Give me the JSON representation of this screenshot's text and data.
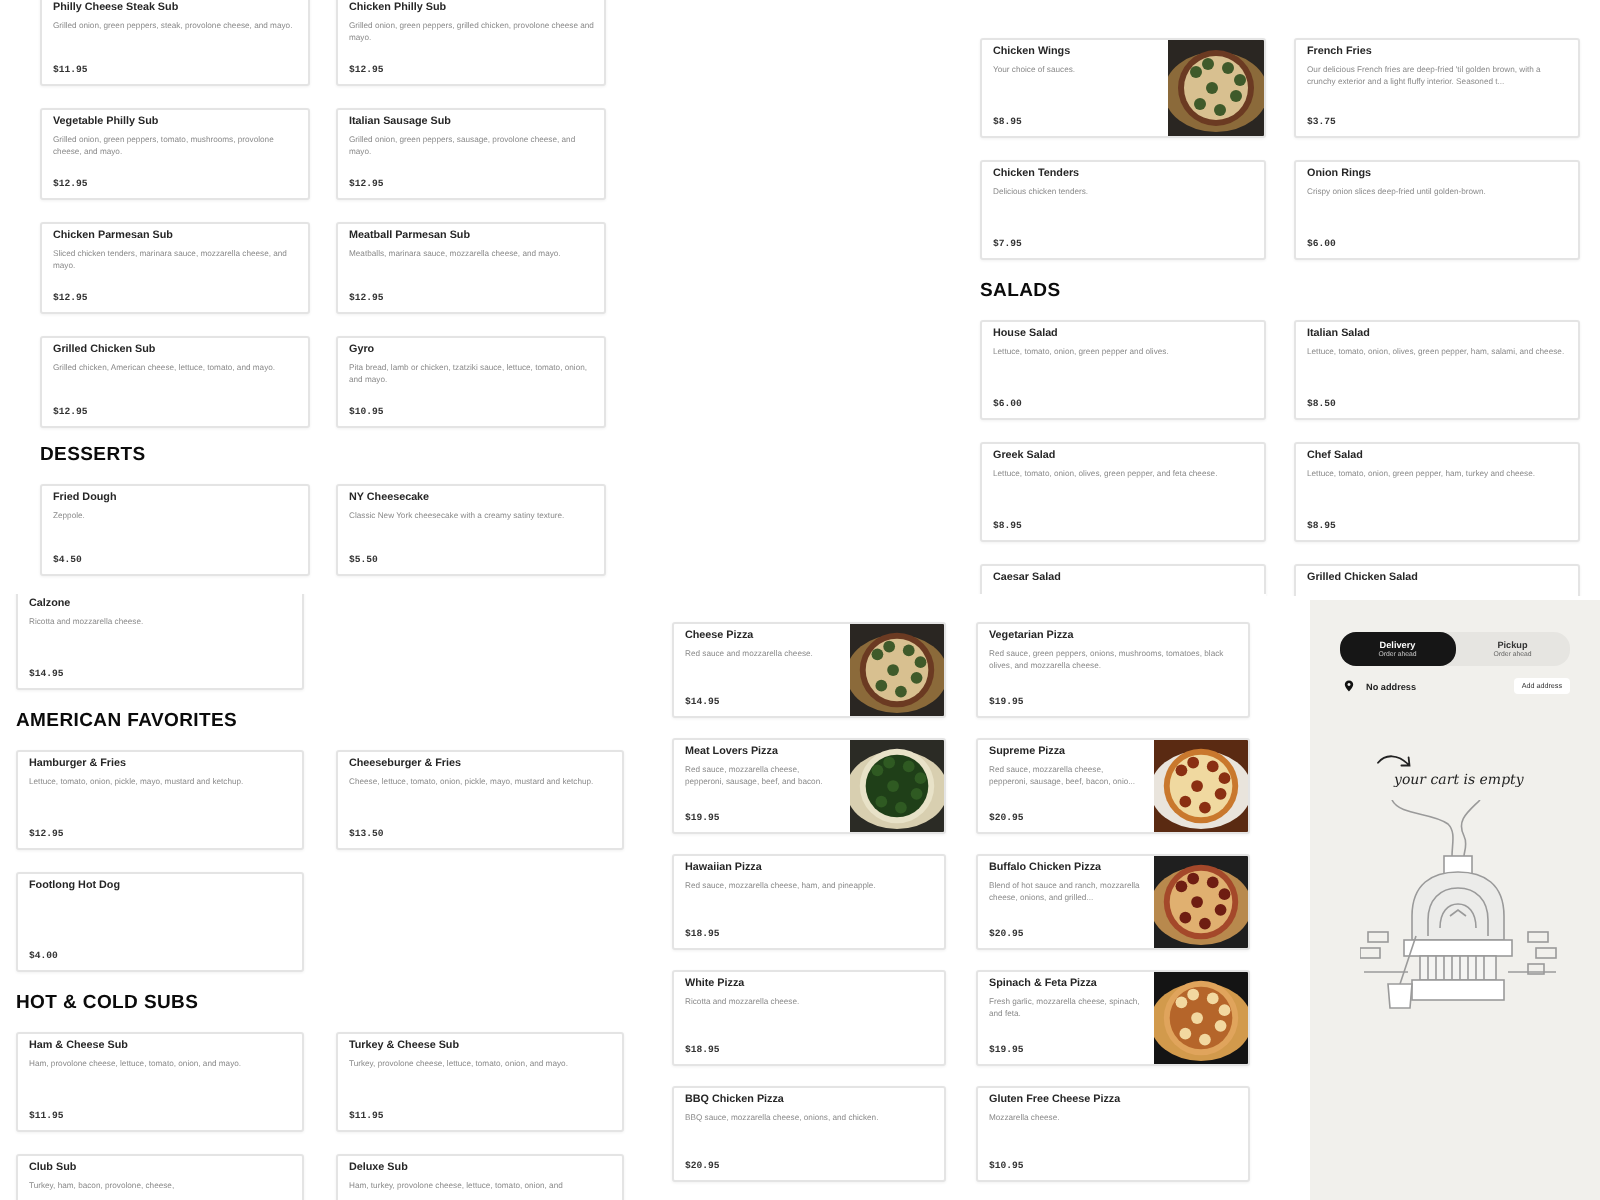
{
  "panels": [
    {
      "kind": "menu",
      "sections": [
        {
          "items": [
            {
              "name": "Philly Cheese Steak Sub",
              "description": "Grilled onion, green peppers, steak, provolone cheese, and mayo.",
              "price": "$11.95"
            },
            {
              "name": "Chicken Philly Sub",
              "description": "Grilled onion, green peppers, grilled chicken, provolone cheese and mayo.",
              "price": "$12.95"
            },
            {
              "name": "Vegetable Philly Sub",
              "description": "Grilled onion, green peppers, tomato, mushrooms, provolone cheese, and mayo.",
              "price": "$12.95"
            },
            {
              "name": "Italian Sausage Sub",
              "description": "Grilled onion, green peppers, sausage, provolone cheese, and mayo.",
              "price": "$12.95"
            },
            {
              "name": "Chicken Parmesan Sub",
              "description": "Sliced chicken tenders, marinara sauce, mozzarella cheese, and mayo.",
              "price": "$12.95"
            },
            {
              "name": "Meatball Parmesan Sub",
              "description": "Meatballs, marinara sauce, mozzarella cheese, and mayo.",
              "price": "$12.95"
            },
            {
              "name": "Grilled Chicken Sub",
              "description": "Grilled chicken, American cheese, lettuce, tomato, and mayo.",
              "price": "$12.95"
            },
            {
              "name": "Gyro",
              "description": "Pita bread, lamb or chicken, tzatziki sauce, lettuce, tomato, onion, and mayo.",
              "price": "$10.95"
            }
          ]
        },
        {
          "heading": "DESSERTS",
          "items": [
            {
              "name": "Fried Dough",
              "description": "Zeppole.",
              "price": "$4.50"
            },
            {
              "name": "NY Cheesecake",
              "description": "Classic New York cheesecake with a creamy satiny texture.",
              "price": "$5.50"
            }
          ]
        }
      ]
    },
    {
      "kind": "menu",
      "sections": [
        {
          "items": [
            {
              "name": "Chicken Wings",
              "description": "Your choice of sauces.",
              "price": "$8.95",
              "photo": true
            },
            {
              "name": "French Fries",
              "description": "Our delicious French fries are deep-fried 'til golden brown, with a crunchy exterior and a light fluffy interior. Seasoned t...",
              "price": "$3.75"
            },
            {
              "name": "Chicken Tenders",
              "description": "Delicious chicken tenders.",
              "price": "$7.95"
            },
            {
              "name": "Onion Rings",
              "description": "Crispy onion slices deep-fried until golden-brown.",
              "price": "$6.00"
            }
          ]
        },
        {
          "heading": "SALADS",
          "items": [
            {
              "name": "House Salad",
              "description": "Lettuce, tomato, onion, green pepper and olives.",
              "price": "$6.00"
            },
            {
              "name": "Italian Salad",
              "description": "Lettuce, tomato, onion, olives, green pepper, ham, salami, and cheese.",
              "price": "$8.50"
            },
            {
              "name": "Greek Salad",
              "description": "Lettuce, tomato, onion, olives, green pepper, and feta cheese.",
              "price": "$8.95"
            },
            {
              "name": "Chef Salad",
              "description": "Lettuce, tomato, onion, green pepper, ham, turkey and cheese.",
              "price": "$8.95"
            },
            {
              "name": "Caesar Salad"
            },
            {
              "name": "Grilled Chicken Salad"
            }
          ]
        }
      ]
    },
    {
      "kind": "menu",
      "sections": [
        {
          "items": [
            {
              "name": "Calzone",
              "description": "Ricotta and mozzarella cheese.",
              "price": "$14.95"
            }
          ]
        },
        {
          "heading": "AMERICAN FAVORITES",
          "items": [
            {
              "name": "Hamburger & Fries",
              "description": "Lettuce, tomato, onion, pickle, mayo, mustard and ketchup.",
              "price": "$12.95"
            },
            {
              "name": "Cheeseburger & Fries",
              "description": "Cheese, lettuce, tomato, onion, pickle, mayo, mustard and ketchup.",
              "price": "$13.50"
            },
            {
              "name": "Footlong Hot Dog",
              "price": "$4.00"
            }
          ]
        },
        {
          "heading": "HOT & COLD SUBS",
          "items": [
            {
              "name": "Ham & Cheese Sub",
              "description": "Ham, provolone cheese, lettuce, tomato, onion, and mayo.",
              "price": "$11.95"
            },
            {
              "name": "Turkey & Cheese Sub",
              "description": "Turkey, provolone cheese, lettuce, tomato, onion, and mayo.",
              "price": "$11.95"
            },
            {
              "name": "Club Sub",
              "description": "Turkey, ham, bacon, provolone, cheese,"
            },
            {
              "name": "Deluxe Sub",
              "description": "Ham, turkey, provolone cheese, lettuce, tomato, onion, and"
            }
          ]
        }
      ]
    },
    {
      "kind": "menu",
      "sections": [
        {
          "items": [
            {
              "name": "Cheese Pizza",
              "description": "Red sauce and mozzarella cheese.",
              "price": "$14.95",
              "photo": true
            },
            {
              "name": "Vegetarian Pizza",
              "description": "Red sauce, green peppers, onions, mushrooms, tomatoes, black olives, and mozzarella cheese.",
              "price": "$19.95"
            },
            {
              "name": "Meat Lovers Pizza",
              "description": "Red sauce, mozzarella cheese, pepperoni, sausage, beef, and bacon.",
              "price": "$19.95",
              "photo": true
            },
            {
              "name": "Supreme Pizza",
              "description": "Red sauce, mozzarella cheese, pepperoni, sausage, beef, bacon, onio...",
              "price": "$20.95",
              "photo": true
            },
            {
              "name": "Hawaiian Pizza",
              "description": "Red sauce, mozzarella cheese, ham, and pineapple.",
              "price": "$18.95"
            },
            {
              "name": "Buffalo Chicken Pizza",
              "description": "Blend of hot sauce and ranch, mozzarella cheese, onions, and grilled...",
              "price": "$20.95",
              "photo": true
            },
            {
              "name": "White Pizza",
              "description": "Ricotta and mozzarella cheese.",
              "price": "$18.95"
            },
            {
              "name": "Spinach & Feta Pizza",
              "description": "Fresh garlic, mozzarella cheese, spinach, and feta.",
              "price": "$19.95",
              "photo": true
            },
            {
              "name": "BBQ Chicken Pizza",
              "description": "BBQ sauce, mozzarella cheese, onions, and chicken.",
              "price": "$20.95"
            },
            {
              "name": "Gluten Free Cheese Pizza",
              "description": "Mozzarella cheese.",
              "price": "$10.95"
            }
          ]
        }
      ]
    },
    {
      "kind": "cart",
      "modes": [
        {
          "label": "Delivery",
          "subtitle": "Order ahead",
          "selected": true
        },
        {
          "label": "Pickup",
          "subtitle": "Order ahead",
          "selected": false
        }
      ],
      "address": "No address",
      "address_button": "Add address",
      "empty_message": "your cart is empty"
    }
  ]
}
